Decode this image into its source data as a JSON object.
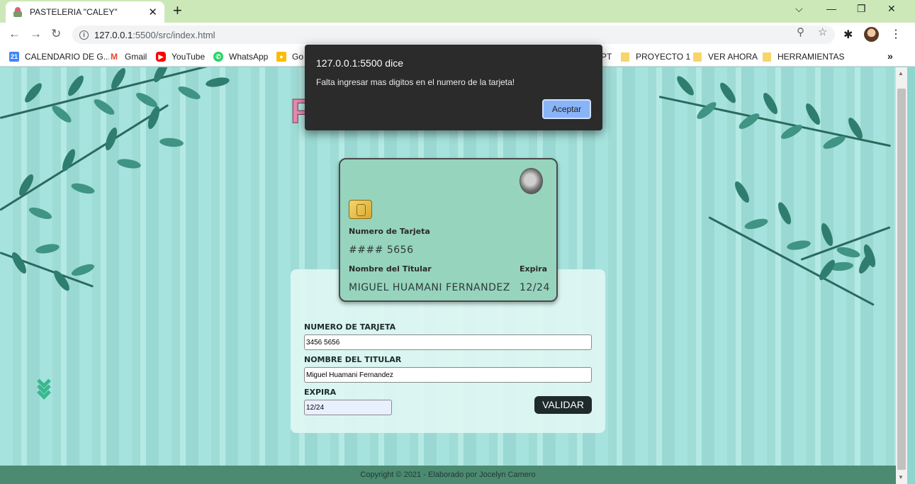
{
  "browser": {
    "tab_title": "PASTELERIA \"CALEY\"",
    "url_host": "127.0.0.1",
    "url_path": ":5500/src/index.html",
    "bookmarks": [
      {
        "label": "CALENDARIO DE G...",
        "icon": "calendar-icon",
        "color": "#4285f4"
      },
      {
        "label": "Gmail",
        "icon": "gmail-icon",
        "color": "#ea4335"
      },
      {
        "label": "YouTube",
        "icon": "youtube-icon",
        "color": "#ff0000"
      },
      {
        "label": "WhatsApp",
        "icon": "whatsapp-icon",
        "color": "#25d366"
      },
      {
        "label": "Go",
        "icon": "google-keep-icon",
        "color": "#fbbc04"
      },
      {
        "label": "PT",
        "icon": "folder-icon",
        "color": "#f8d56b"
      },
      {
        "label": "PROYECTO 1",
        "icon": "folder-icon",
        "color": "#f8d56b"
      },
      {
        "label": "VER AHORA",
        "icon": "folder-icon",
        "color": "#f8d56b"
      },
      {
        "label": "HERRAMIENTAS",
        "icon": "folder-icon",
        "color": "#f8d56b"
      }
    ]
  },
  "dialog": {
    "title": "127.0.0.1:5500 dice",
    "message": "Falta ingresar mas digitos en el numero de la tarjeta!",
    "button_label": "Aceptar"
  },
  "logo": {
    "visible_letter": "P"
  },
  "card": {
    "number_label": "Numero de Tarjeta",
    "number_value": "#### 5656",
    "holder_label": "Nombre del Titular",
    "holder_value": "MIGUEL HUAMANI FERNANDEZ",
    "expiry_label": "Expira",
    "expiry_value": "12/24"
  },
  "form": {
    "card_number_label": "NUMERO DE TARJETA",
    "card_number_value": "3456 5656",
    "holder_label": "NOMBRE DEL TITULAR",
    "holder_value": "Miguel Huamani Fernandez",
    "expiry_label": "EXPIRA",
    "expiry_value": "12/24",
    "submit_label": "VALIDAR"
  },
  "footer": {
    "text": "Copyright © 2021 - Elaborado por Jocelyn Camero"
  },
  "colors": {
    "background": "#a6e3de",
    "card": "#96d4bd",
    "footer": "#4c8a72",
    "dialog": "#2b2b2b",
    "dialog_button": "#8ab4f8"
  }
}
